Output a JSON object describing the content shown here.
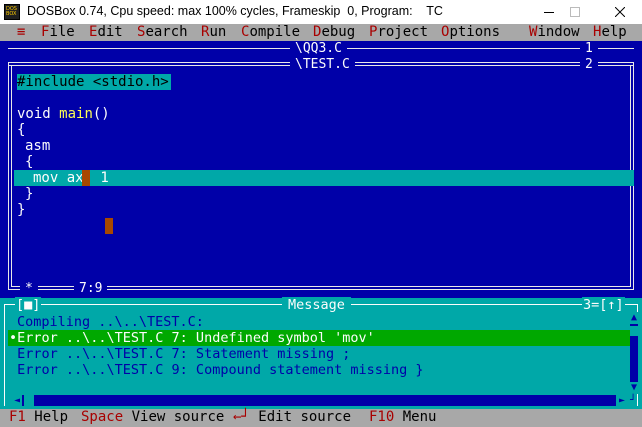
{
  "window": {
    "title": "DOSBox 0.74, Cpu speed: max 100% cycles, Frameskip  0, Program:    TC",
    "icon_text": "DOS BOX"
  },
  "menu": {
    "system": "≡",
    "items": [
      {
        "hot": "F",
        "rest": "ile"
      },
      {
        "hot": "E",
        "rest": "dit"
      },
      {
        "hot": "S",
        "rest": "earch"
      },
      {
        "hot": "R",
        "rest": "un"
      },
      {
        "hot": "C",
        "rest": "ompile"
      },
      {
        "hot": "D",
        "rest": "ebug"
      },
      {
        "hot": "P",
        "rest": "roject"
      },
      {
        "hot": "O",
        "rest": "ptions"
      },
      {
        "hot": "W",
        "rest": "indow"
      },
      {
        "hot": "H",
        "rest": "elp"
      }
    ]
  },
  "editor": {
    "tab_back": {
      "name": "\\QQ3.C",
      "number": "1"
    },
    "tab_front": {
      "name": "\\TEST.C",
      "number": "2"
    },
    "close_box": "[■]",
    "zoom_box": "[↕]",
    "lines": {
      "l1": "#include <stdio.h>",
      "l2a": "void ",
      "l2b": "main",
      "l2c": "()",
      "l3": "{",
      "l4": "asm",
      "l5": "{",
      "l6a": "mov ax",
      "l6b": ", 1",
      "l7": "}",
      "l8": "}"
    },
    "modified_marker": "*",
    "position": "7:9"
  },
  "message": {
    "close_box": "[■]",
    "title": "Message",
    "number": "3",
    "zoom_box": "[↑]",
    "lines": [
      "Compiling ..\\..\\TEST.C:",
      "•Error ..\\..\\TEST.C 7: Undefined symbol 'mov'",
      " Error ..\\..\\TEST.C 7: Statement missing ;",
      " Error ..\\..\\TEST.C 9: Compound statement missing }"
    ]
  },
  "status": {
    "f1_key": "F1",
    "f1_label": "Help",
    "space_key": "Space",
    "space_label": "View source",
    "enter_key": "←┘",
    "enter_label": "Edit source",
    "f10_key": "F10",
    "f10_label": "Menu"
  },
  "colors": {
    "dos_blue": "#0000a8",
    "cyan": "#00a8a8",
    "gray": "#a8a8a8",
    "hot_red": "#a80000",
    "highlight_green": "#00a800",
    "keyword_yellow": "#fcfc54"
  }
}
